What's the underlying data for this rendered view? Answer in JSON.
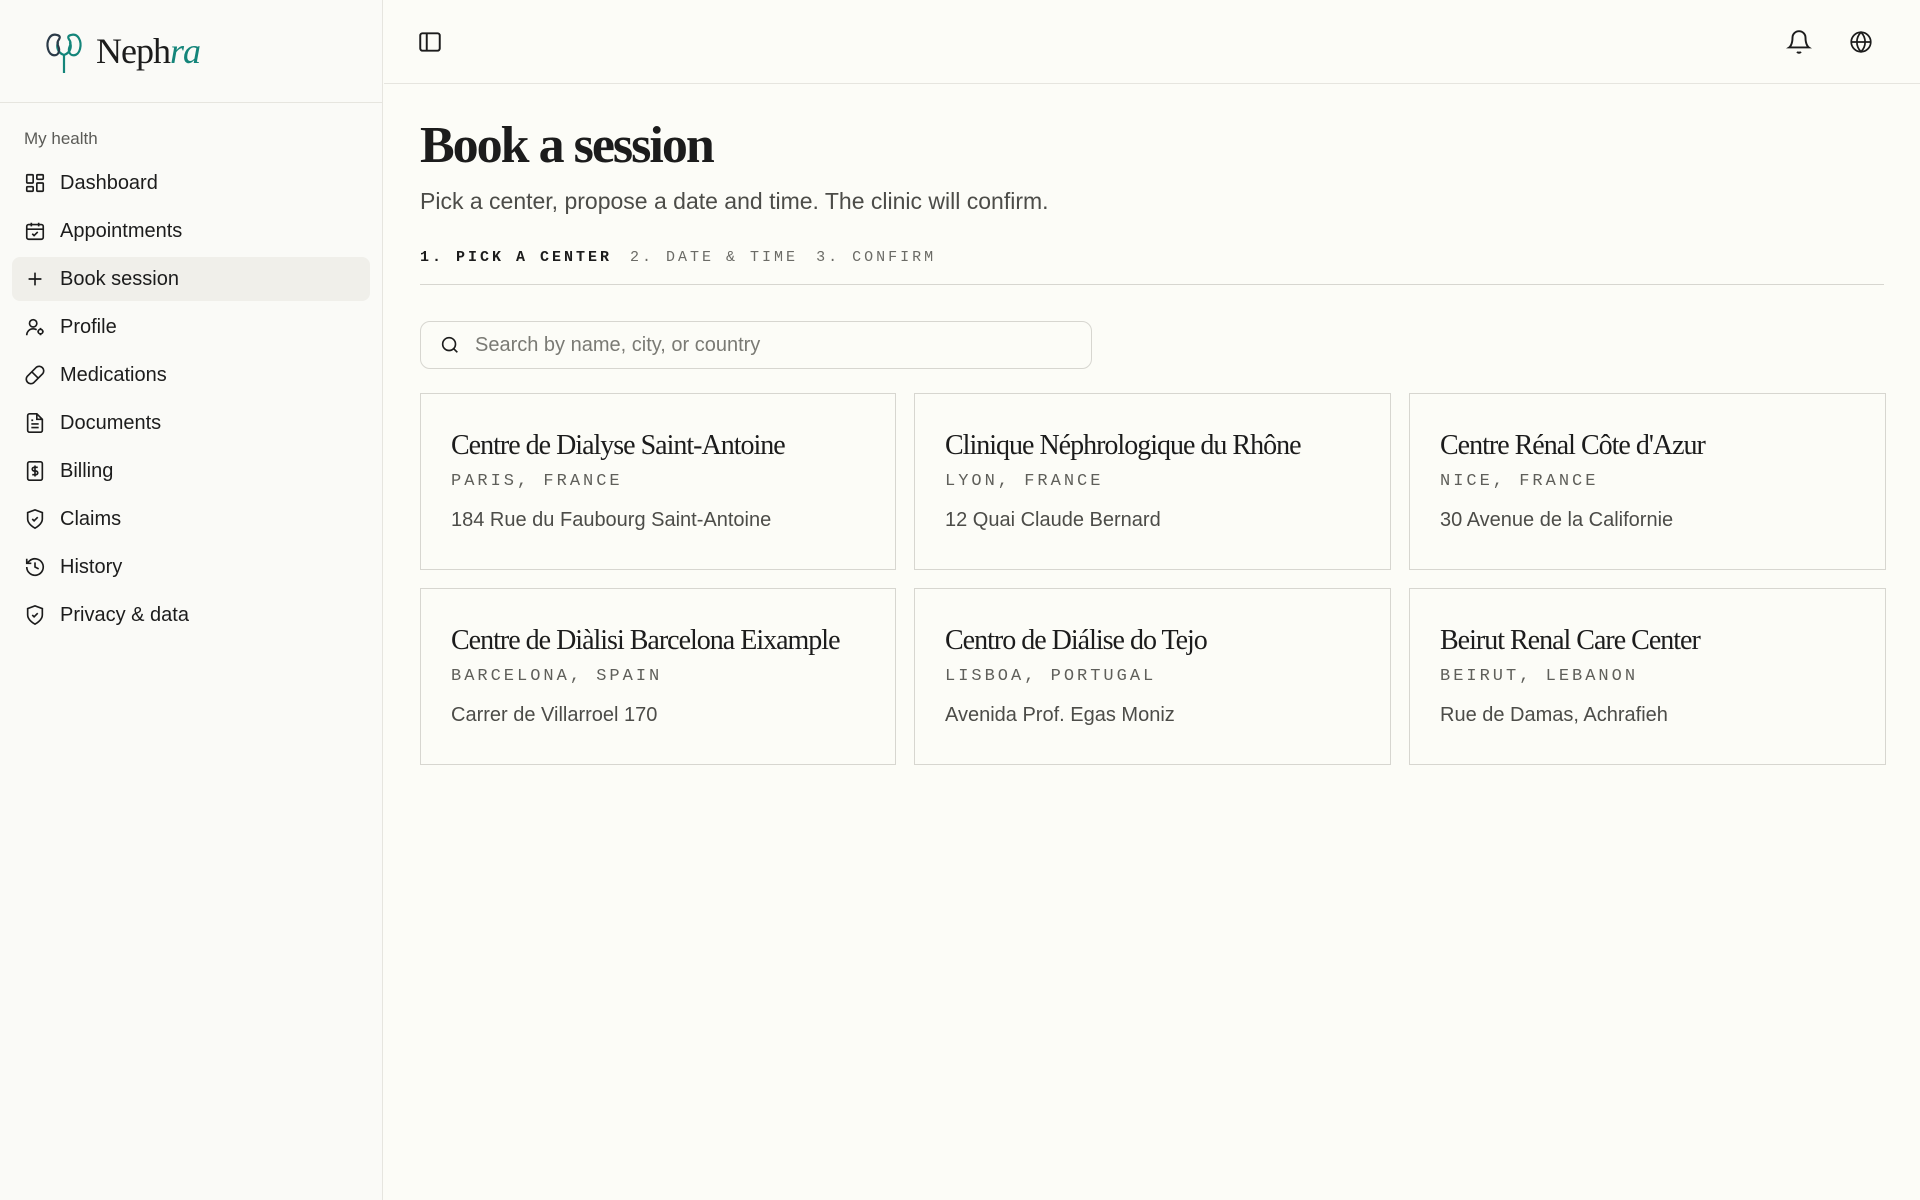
{
  "brand": {
    "name_plain": "Neph",
    "name_accent": "ra",
    "accent_color": "#14857a"
  },
  "sidebar": {
    "section_label": "My health",
    "items": [
      {
        "label": "Dashboard",
        "icon": "dashboard-icon"
      },
      {
        "label": "Appointments",
        "icon": "calendar-icon"
      },
      {
        "label": "Book session",
        "icon": "plus-icon",
        "active": true
      },
      {
        "label": "Profile",
        "icon": "user-settings-icon"
      },
      {
        "label": "Medications",
        "icon": "pill-icon"
      },
      {
        "label": "Documents",
        "icon": "document-icon"
      },
      {
        "label": "Billing",
        "icon": "dollar-receipt-icon"
      },
      {
        "label": "Claims",
        "icon": "shield-check-icon"
      },
      {
        "label": "History",
        "icon": "history-icon"
      },
      {
        "label": "Privacy & data",
        "icon": "shield-check-icon"
      }
    ]
  },
  "topbar": {
    "icons": [
      "sidebar-toggle-icon",
      "bell-icon",
      "globe-icon"
    ]
  },
  "main": {
    "title": "Book a session",
    "subtitle": "Pick a center, propose a date and time. The clinic will confirm.",
    "steps": [
      "1. PICK A CENTER",
      "2. DATE & TIME",
      "3. CONFIRM"
    ],
    "search_placeholder": "Search by name, city, or country",
    "centers": [
      {
        "name": "Centre de Dialyse Saint-Antoine",
        "location": "PARIS, FRANCE",
        "address": "184 Rue du Faubourg Saint-Antoine"
      },
      {
        "name": "Clinique Néphrologique du Rhône",
        "location": "LYON, FRANCE",
        "address": "12 Quai Claude Bernard"
      },
      {
        "name": "Centre Rénal Côte d'Azur",
        "location": "NICE, FRANCE",
        "address": "30 Avenue de la Californie"
      },
      {
        "name": "Centre de Diàlisi Barcelona Eixample",
        "location": "BARCELONA, SPAIN",
        "address": "Carrer de Villarroel 170"
      },
      {
        "name": "Centro de Diálise do Tejo",
        "location": "LISBOA, PORTUGAL",
        "address": "Avenida Prof. Egas Moniz"
      },
      {
        "name": "Beirut Renal Care Center",
        "location": "BEIRUT, LEBANON",
        "address": "Rue de Damas, Achrafieh"
      }
    ]
  }
}
